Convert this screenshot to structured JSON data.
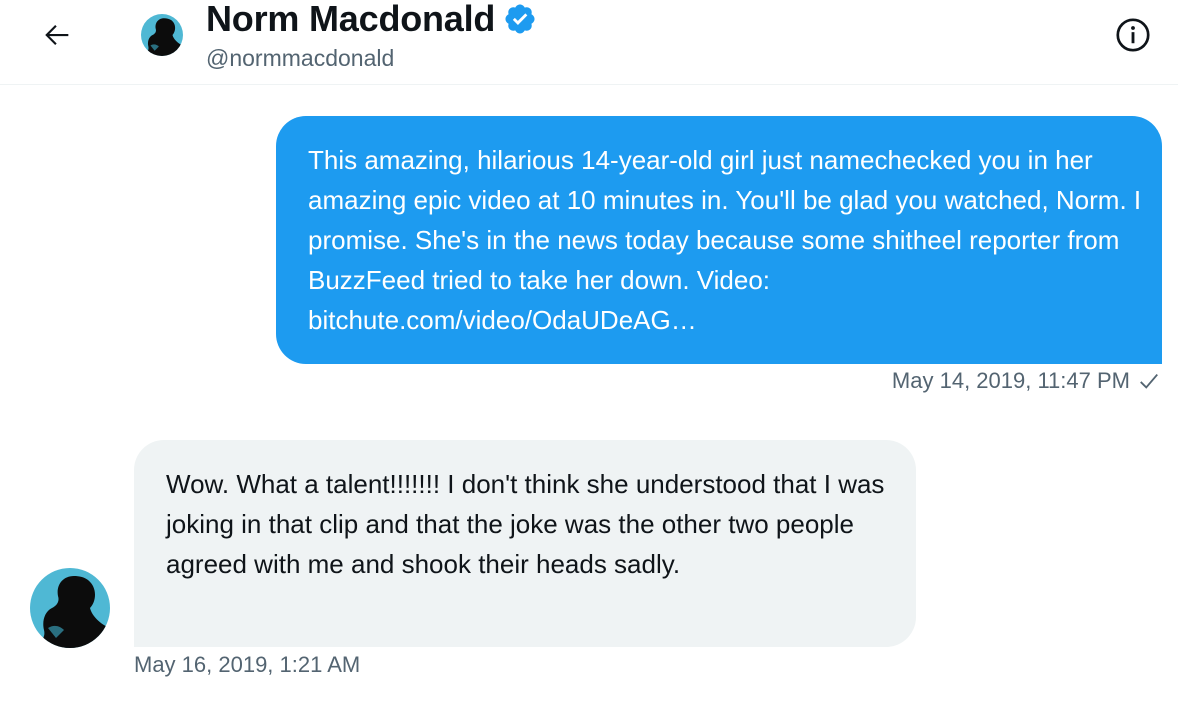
{
  "header": {
    "back_icon": "arrow-left-icon",
    "display_name": "Norm Macdonald",
    "verified_icon": "verified-badge-icon",
    "handle": "@normmacdonald",
    "info_icon": "info-icon"
  },
  "messages": [
    {
      "direction": "sent",
      "text": "This amazing, hilarious 14-year-old girl just namechecked you in her amazing epic video at 10 minutes in. You'll be glad you watched, Norm. I promise. She's in the news today because some shitheel reporter from BuzzFeed tried to take her down. Video: bitchute.com/video/OdaUDeAG…",
      "timestamp": "May 14, 2019, 11:47 PM",
      "status_icon": "sent-check-icon"
    },
    {
      "direction": "received",
      "text": "Wow. What a talent!!!!!!! I don't think she understood that I was joking in that clip and that the joke was the other two people agreed with me and shook their heads sadly.",
      "timestamp": "May 16, 2019, 1:21 AM"
    }
  ],
  "colors": {
    "accent": "#1d9bf0",
    "received_bubble": "#eff3f4",
    "secondary_text": "#536471",
    "avatar_bg": "#4fb8d4"
  }
}
